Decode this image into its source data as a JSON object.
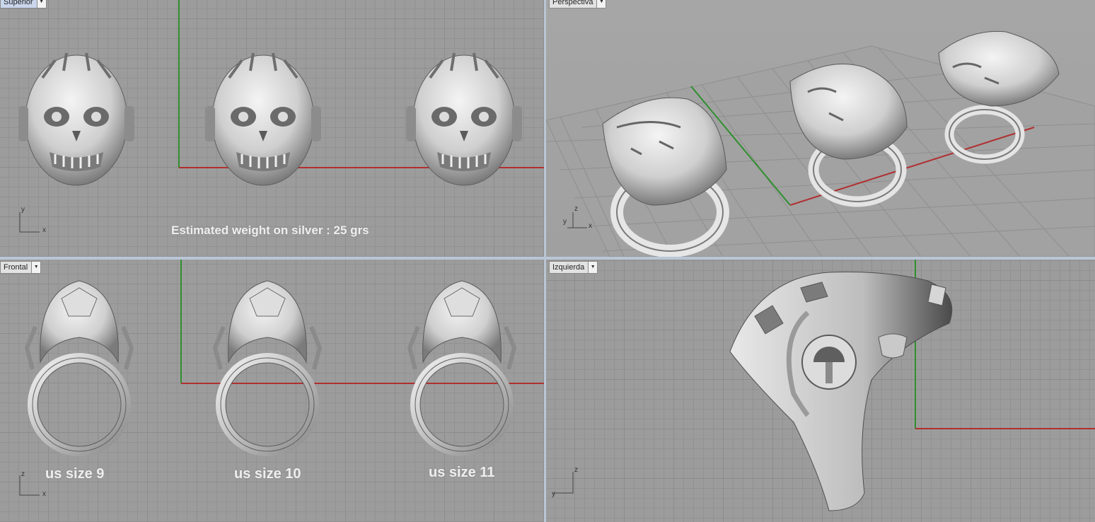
{
  "viewports": {
    "top": {
      "label": "Superior",
      "annotation": "Estimated weight on silver : 25 grs",
      "axes": [
        "y",
        "x"
      ]
    },
    "persp": {
      "label": "Perspectiva",
      "axes": [
        "z",
        "y",
        "x"
      ]
    },
    "front": {
      "label": "Frontal",
      "axes": [
        "z",
        "x"
      ],
      "sizes": [
        "us size 9",
        "us size 10",
        "us size 11"
      ]
    },
    "left": {
      "label": "Izquierda",
      "axes": [
        "z",
        "y"
      ]
    }
  },
  "icons": {
    "dropdown": "chevron-down-icon"
  },
  "colors": {
    "x_axis": "#b03030",
    "y_axis": "#2f8f2f",
    "viewport_bg": "#9c9c9c",
    "active_tab": "#c9d6ec"
  }
}
